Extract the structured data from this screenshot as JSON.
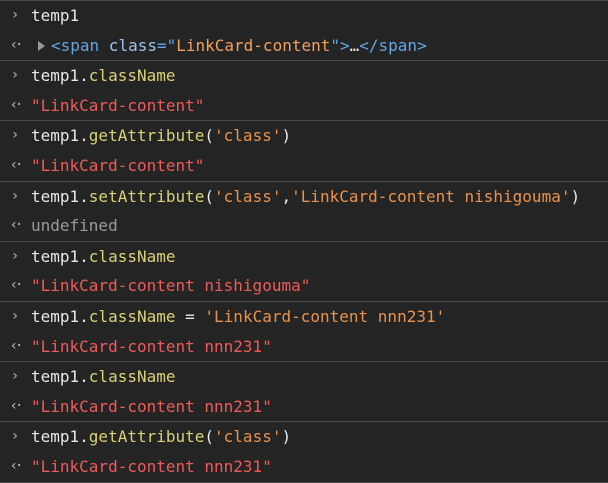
{
  "icons": {
    "prompt": "chevron-right-icon",
    "result": "return-arrow-icon",
    "expand": "triangle-right-icon"
  },
  "entries": [
    {
      "input": [
        {
          "t": "temp1",
          "c": "default"
        }
      ],
      "output": [
        {
          "t": "<span",
          "c": "tag"
        },
        {
          "t": " class",
          "c": "attr"
        },
        {
          "t": "=\"",
          "c": "tag"
        },
        {
          "t": "LinkCard-content",
          "c": "attrval"
        },
        {
          "t": "\">",
          "c": "tag"
        },
        {
          "t": "…",
          "c": "default"
        },
        {
          "t": "</span>",
          "c": "tag"
        }
      ],
      "expandable": true
    },
    {
      "input": [
        {
          "t": "temp1.",
          "c": "default"
        },
        {
          "t": "className",
          "c": "prop"
        }
      ],
      "output": [
        {
          "t": "\"LinkCard-content\"",
          "c": "red"
        }
      ]
    },
    {
      "input": [
        {
          "t": "temp1.",
          "c": "default"
        },
        {
          "t": "getAttribute",
          "c": "prop"
        },
        {
          "t": "(",
          "c": "default"
        },
        {
          "t": "'class'",
          "c": "str"
        },
        {
          "t": ")",
          "c": "default"
        }
      ],
      "output": [
        {
          "t": "\"LinkCard-content\"",
          "c": "red"
        }
      ]
    },
    {
      "input": [
        {
          "t": "temp1.",
          "c": "default"
        },
        {
          "t": "setAttribute",
          "c": "prop"
        },
        {
          "t": "(",
          "c": "default"
        },
        {
          "t": "'class'",
          "c": "str"
        },
        {
          "t": ",",
          "c": "default"
        },
        {
          "t": "'LinkCard-content nishigouma'",
          "c": "str"
        },
        {
          "t": ")",
          "c": "default"
        }
      ],
      "output": [
        {
          "t": "undefined",
          "c": "undef"
        }
      ]
    },
    {
      "input": [
        {
          "t": "temp1.",
          "c": "default"
        },
        {
          "t": "className",
          "c": "prop"
        }
      ],
      "output": [
        {
          "t": "\"LinkCard-content nishigouma\"",
          "c": "red"
        }
      ]
    },
    {
      "input": [
        {
          "t": "temp1.",
          "c": "default"
        },
        {
          "t": "className",
          "c": "prop"
        },
        {
          "t": " = ",
          "c": "default"
        },
        {
          "t": "'LinkCard-content nnn231'",
          "c": "str"
        }
      ],
      "output": [
        {
          "t": "\"LinkCard-content nnn231\"",
          "c": "red"
        }
      ]
    },
    {
      "input": [
        {
          "t": "temp1.",
          "c": "default"
        },
        {
          "t": "className",
          "c": "prop"
        }
      ],
      "output": [
        {
          "t": "\"LinkCard-content nnn231\"",
          "c": "red"
        }
      ]
    },
    {
      "input": [
        {
          "t": "temp1.",
          "c": "default"
        },
        {
          "t": "getAttribute",
          "c": "prop"
        },
        {
          "t": "(",
          "c": "default"
        },
        {
          "t": "'class'",
          "c": "str"
        },
        {
          "t": ")",
          "c": "default"
        }
      ],
      "output": [
        {
          "t": "\"LinkCard-content nnn231\"",
          "c": "red"
        }
      ]
    }
  ]
}
